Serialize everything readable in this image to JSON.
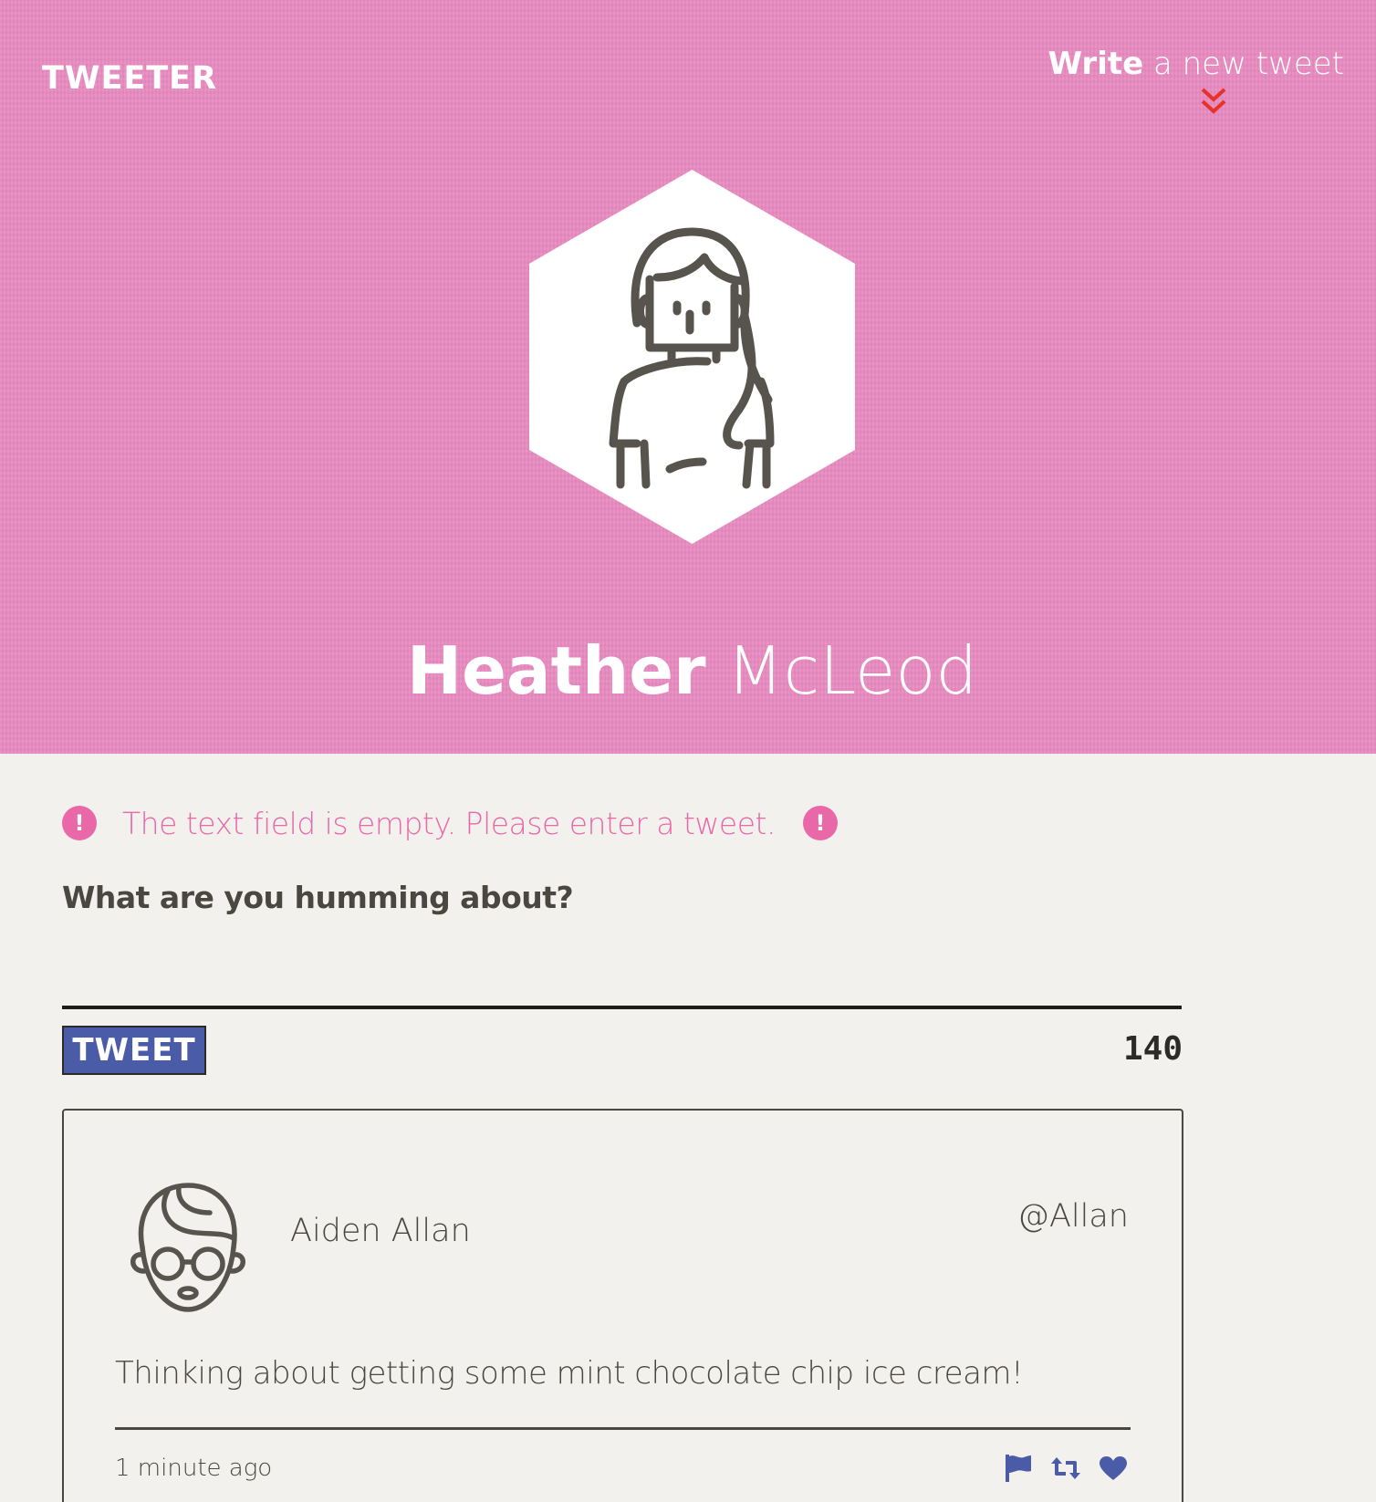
{
  "header": {
    "logo": "TWEETER",
    "compose_link_strong": "Write",
    "compose_link_rest": " a new tweet",
    "background_color": "#e88ac0",
    "profile": {
      "first_name": "Heather",
      "last_name": "McLeod",
      "avatar_icon": "woman-avatar-icon"
    }
  },
  "compose": {
    "error": {
      "icon": "exclamation-icon",
      "text": "The text field is empty. Please enter a tweet."
    },
    "label": "What are you humming about?",
    "input_value": "",
    "submit_label": "TWEET",
    "char_count": "140",
    "accent_color": "#4a5ca8",
    "error_color": "#e868a8"
  },
  "tweets": [
    {
      "avatar_icon": "man-with-glasses-avatar-icon",
      "name": "Aiden Allan",
      "handle": "@Allan",
      "content": "Thinking about getting some mint chocolate chip ice cream!",
      "timestamp": "1 minute ago",
      "actions": [
        "flag-icon",
        "retweet-icon",
        "heart-icon"
      ]
    }
  ]
}
